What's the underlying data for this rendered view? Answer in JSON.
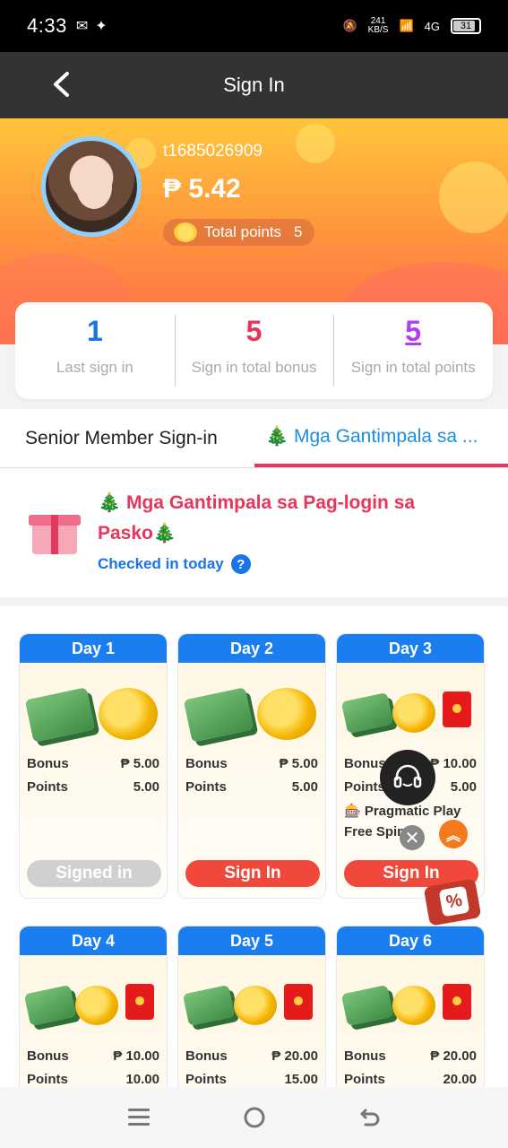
{
  "status_bar": {
    "time": "4:33",
    "network_speed": "241\nKB/S",
    "network_type": "4G",
    "battery": "31"
  },
  "app_bar": {
    "title": "Sign In"
  },
  "profile": {
    "username": "t1685026909",
    "balance": "₱ 5.42",
    "total_points_label": "Total points",
    "total_points_value": "5"
  },
  "stats": [
    {
      "value": "1",
      "label": "Last sign in",
      "color": "#1a73e8"
    },
    {
      "value": "5",
      "label": "Sign in total bonus",
      "color": "#e8355a"
    },
    {
      "value": "5",
      "label": "Sign in total points",
      "color": "#b43cf0"
    }
  ],
  "tabs": {
    "senior": "Senior Member Sign-in",
    "christmas": "🎄 Mga Gantimpala sa ..."
  },
  "promo": {
    "title": "🎄 Mga Gantimpala sa Pag-login sa Pasko🎄",
    "checked_label": "Checked in today",
    "help_icon": "?"
  },
  "days": [
    {
      "day": "Day 1",
      "bonus_label": "Bonus",
      "bonus": "₱ 5.00",
      "points_label": "Points",
      "points": "5.00",
      "extra1": "",
      "extra2": "",
      "button": "Signed in"
    },
    {
      "day": "Day 2",
      "bonus_label": "Bonus",
      "bonus": "₱ 5.00",
      "points_label": "Points",
      "points": "5.00",
      "extra1": "",
      "extra2": "",
      "button": "Sign In"
    },
    {
      "day": "Day 3",
      "bonus_label": "Bonus",
      "bonus": "₱ 10.00",
      "points_label": "Points",
      "points": "5.00",
      "extra1": "🎰 Pragmatic Play",
      "extra2": "Free Spins",
      "button": "Sign In"
    },
    {
      "day": "Day 4",
      "bonus_label": "Bonus",
      "bonus": "₱ 10.00",
      "points_label": "Points",
      "points": "10.00"
    },
    {
      "day": "Day 5",
      "bonus_label": "Bonus",
      "bonus": "₱ 20.00",
      "points_label": "Points",
      "points": "15.00"
    },
    {
      "day": "Day 6",
      "bonus_label": "Bonus",
      "bonus": "₱ 20.00",
      "points_label": "Points",
      "points": "20.00"
    }
  ],
  "floating": {
    "close": "✕",
    "up": "︽",
    "promo_badge": "%"
  }
}
